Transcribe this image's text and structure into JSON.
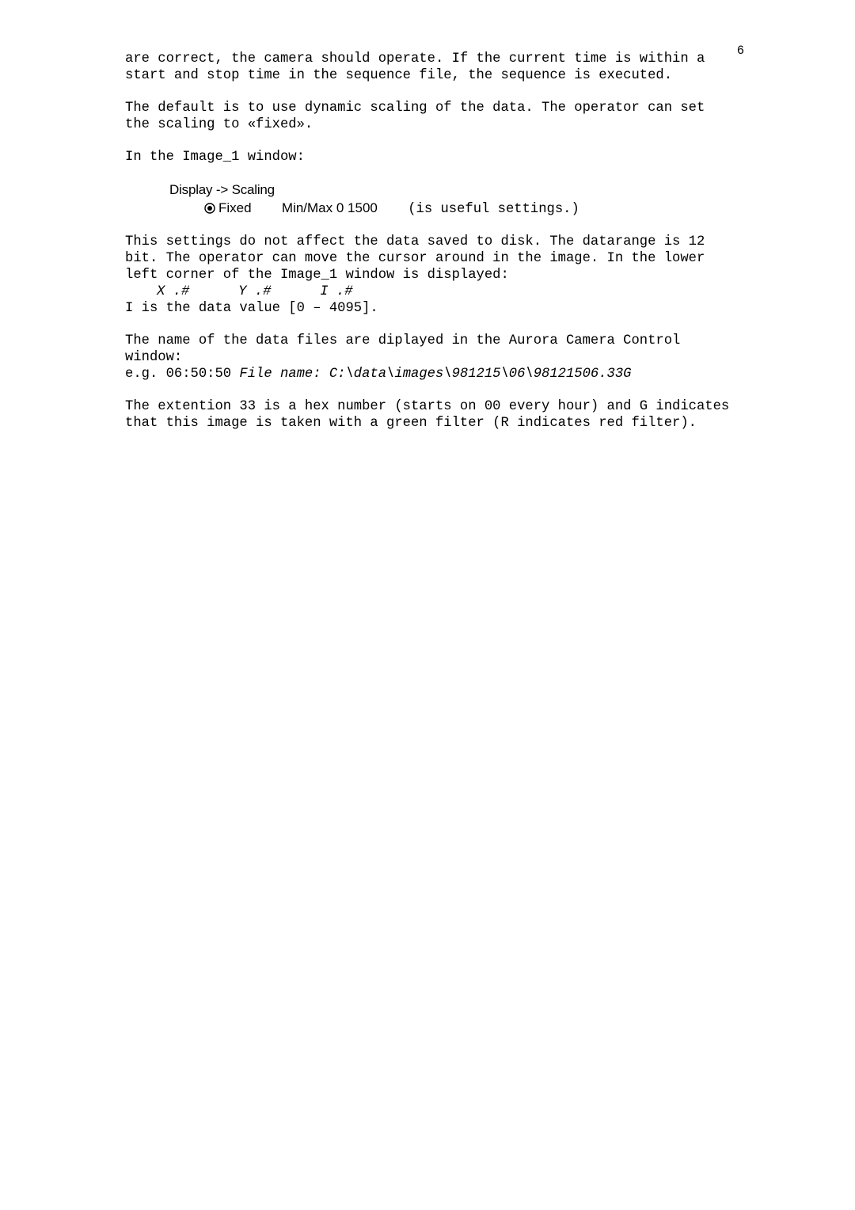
{
  "page_number": "6",
  "p1": "are correct, the camera should operate. If the current time is within a start and stop time in the sequence file, the sequence is executed.",
  "p2": "The default is to use dynamic scaling of the data. The operator can set the scaling to «fixed».",
  "p3": "In the Image_1 window:",
  "menu": {
    "line1": "Display ->  Scaling",
    "fixed_label": "Fixed",
    "minmax_label": "Min/Max 0   1500",
    "useful": "(is useful settings.)"
  },
  "p4": "This settings do not affect the data saved to disk. The datarange is 12 bit. The operator can move the cursor around in the image. In the lower left corner of the Image_1 window is displayed:",
  "xyi": "X .#      Y .#      I .#",
  "p5": "I is the data value [0 – 4095].",
  "p6a": "The name of the data files are diplayed in the Aurora Camera Control window:",
  "p6b_prefix": "e.g. 06:50:50  ",
  "p6b_filename": "File name: C:\\data\\images\\981215\\06\\98121506.33G",
  "p7": "The extention 33 is a hex number (starts on 00 every hour) and G indicates that this image is taken with a green filter (R indicates red filter)."
}
